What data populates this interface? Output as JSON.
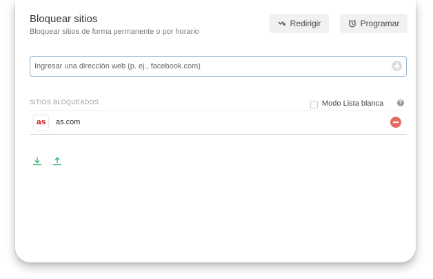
{
  "header": {
    "title": "Bloquear sitios",
    "subtitle": "Bloquear sitios de forma permanente o por horario",
    "redirect_label": "Redirigir",
    "schedule_label": "Programar"
  },
  "input": {
    "placeholder": "Ingresar una dirección web (p. ej., facebook.com)"
  },
  "blocked": {
    "section_label": "SITIOS BLOQUEADOS",
    "whitelist_label": "Modo Lista blanca",
    "whitelist_checked": false,
    "help_glyph": "?",
    "items": [
      {
        "favicon_text": "as",
        "domain": "as.com"
      }
    ]
  },
  "icons": {
    "redirect": "redirect-arrow-icon",
    "schedule": "alarm-clock-icon",
    "add": "plus-circle-icon",
    "remove": "minus-circle-icon",
    "download": "download-icon",
    "upload": "upload-icon"
  },
  "colors": {
    "accent_green": "#2bb673",
    "remove_red": "#e56a66",
    "input_border": "#8fb6d6"
  }
}
